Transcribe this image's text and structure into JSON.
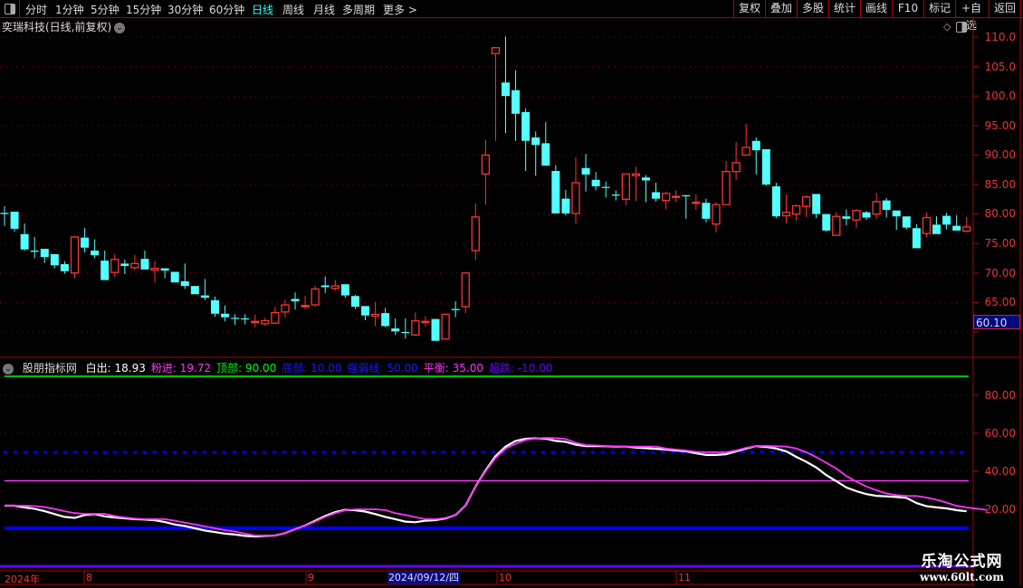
{
  "toolbar": {
    "periods": [
      "分时",
      "1分钟",
      "5分钟",
      "15分钟",
      "30分钟",
      "60分钟",
      "日线",
      "周线",
      "月线",
      "多周期",
      "更多 >"
    ],
    "active_period": "日线",
    "buttons": [
      "复权",
      "叠加",
      "多股",
      "统计",
      "画线",
      "F10",
      "标记",
      "+自选",
      "返回"
    ]
  },
  "main": {
    "title": "奕瑞科技(日线,前复权)",
    "price_axis": [
      "110.0",
      "105.0",
      "100.0",
      "95.00",
      "90.00",
      "85.00",
      "80.00",
      "75.00",
      "70.00",
      "65.00"
    ],
    "cursor_price": "60.10"
  },
  "indicator": {
    "name": "股朋指标网",
    "values": [
      {
        "label": "白出",
        "value": "18.93",
        "color": "#ffffff"
      },
      {
        "label": "粉进",
        "value": "19.72",
        "color": "#ff33ff"
      },
      {
        "label": "顶部",
        "value": "90.00",
        "color": "#00ff00"
      },
      {
        "label": "底部",
        "value": "10.00",
        "color": "#0000ff"
      },
      {
        "label": "强弱线",
        "value": "50.00",
        "color": "#0000ff"
      },
      {
        "label": "平衡",
        "value": "35.00",
        "color": "#ff33ff"
      },
      {
        "label": "超跌",
        "value": "-10.00",
        "color": "#6600ff"
      }
    ],
    "axis": [
      "80.00",
      "60.00",
      "40.00",
      "20.00"
    ]
  },
  "date_axis": {
    "labels": [
      "2024年",
      "8",
      "9",
      "10",
      "11"
    ],
    "highlight": "2024/09/12/四"
  },
  "watermark": {
    "line1": "乐淘公式网",
    "line2": "www.60lt.com"
  },
  "chart_data": {
    "type": "candlestick",
    "up_color": "#ff3333",
    "down_color": "#54ffff",
    "ylim": [
      59,
      111
    ],
    "ohlc": [
      [
        80.2,
        81.3,
        78.0,
        80.0
      ],
      [
        80.4,
        80.4,
        77.0,
        77.5
      ],
      [
        76.6,
        78.4,
        73.8,
        74.0
      ],
      [
        73.8,
        76.1,
        72.5,
        73.6
      ],
      [
        74.1,
        74.1,
        71.7,
        72.7
      ],
      [
        73.2,
        73.2,
        70.8,
        71.3
      ],
      [
        71.5,
        72.0,
        69.9,
        70.3
      ],
      [
        70.0,
        76.3,
        69.1,
        76.1
      ],
      [
        76.0,
        77.6,
        73.5,
        74.3
      ],
      [
        73.8,
        75.7,
        72.5,
        73.0
      ],
      [
        72.1,
        73.8,
        68.8,
        68.8
      ],
      [
        70.1,
        73.2,
        69.3,
        72.3
      ],
      [
        71.6,
        72.3,
        69.8,
        71.2
      ],
      [
        70.9,
        73.1,
        70.5,
        71.6
      ],
      [
        72.4,
        73.8,
        70.6,
        70.6
      ],
      [
        70.5,
        72.1,
        68.4,
        70.8
      ],
      [
        70.8,
        70.8,
        69.1,
        70.4
      ],
      [
        70.2,
        70.2,
        68.4,
        68.4
      ],
      [
        68.6,
        71.6,
        67.3,
        67.8
      ],
      [
        67.8,
        67.8,
        66.4,
        66.4
      ],
      [
        66.2,
        69.0,
        65.4,
        65.8
      ],
      [
        65.4,
        66.0,
        62.6,
        63.1
      ],
      [
        63.1,
        64.5,
        61.8,
        62.5
      ],
      [
        62.4,
        63.0,
        61.2,
        62.3
      ],
      [
        62.3,
        63.0,
        61.3,
        62.2
      ],
      [
        61.7,
        63.0,
        60.8,
        61.8
      ],
      [
        61.4,
        62.4,
        61.0,
        61.9
      ],
      [
        61.5,
        64.2,
        61.5,
        63.3
      ],
      [
        63.4,
        65.5,
        62.4,
        64.6
      ],
      [
        65.6,
        66.7,
        63.8,
        65.2
      ],
      [
        64.3,
        66.1,
        63.9,
        64.5
      ],
      [
        64.6,
        67.8,
        64.3,
        67.3
      ],
      [
        67.9,
        69.4,
        66.6,
        67.6
      ],
      [
        67.4,
        68.8,
        67.0,
        67.8
      ],
      [
        68.1,
        68.1,
        65.8,
        66.2
      ],
      [
        66.1,
        66.3,
        63.9,
        64.3
      ],
      [
        64.4,
        64.4,
        62.0,
        62.8
      ],
      [
        62.7,
        65.1,
        61.0,
        63.0
      ],
      [
        63.2,
        64.1,
        60.8,
        61.0
      ],
      [
        60.6,
        62.3,
        59.5,
        60.1
      ],
      [
        60.0,
        62.3,
        58.9,
        59.9
      ],
      [
        59.5,
        63.3,
        59.3,
        61.9
      ],
      [
        61.7,
        62.7,
        60.9,
        61.8
      ],
      [
        62.2,
        62.2,
        58.5,
        58.5
      ],
      [
        58.8,
        63.0,
        58.8,
        63.0
      ],
      [
        63.9,
        65.2,
        62.5,
        63.7
      ],
      [
        64.3,
        70.0,
        63.2,
        70.0
      ],
      [
        73.8,
        81.8,
        72.2,
        79.5
      ],
      [
        86.8,
        92.5,
        81.6,
        90.0
      ],
      [
        107.2,
        108.2,
        92.4,
        108.2
      ],
      [
        102.3,
        110.1,
        93.7,
        100.0
      ],
      [
        101.0,
        104.4,
        92.4,
        97.0
      ],
      [
        97.3,
        97.9,
        87.3,
        92.4
      ],
      [
        93.0,
        94.0,
        86.5,
        91.7
      ],
      [
        92.0,
        95.6,
        88.2,
        88.2
      ],
      [
        87.3,
        88.3,
        80.1,
        80.1
      ],
      [
        82.6,
        84.1,
        79.8,
        80.1
      ],
      [
        80.1,
        89.6,
        78.4,
        85.3
      ],
      [
        87.8,
        90.2,
        83.8,
        86.7
      ],
      [
        85.8,
        87.1,
        84.0,
        84.7
      ],
      [
        84.6,
        85.5,
        82.8,
        84.5
      ],
      [
        83.3,
        84.0,
        82.3,
        83.2
      ],
      [
        82.5,
        86.8,
        81.5,
        86.8
      ],
      [
        86.5,
        88.0,
        82.2,
        86.8
      ],
      [
        86.2,
        86.6,
        82.0,
        85.7
      ],
      [
        83.7,
        85.3,
        82.1,
        82.6
      ],
      [
        82.3,
        83.8,
        80.8,
        83.5
      ],
      [
        82.9,
        84.0,
        82.0,
        83.0
      ],
      [
        83.2,
        83.2,
        79.2,
        83.0
      ],
      [
        81.9,
        83.4,
        80.7,
        82.0
      ],
      [
        81.9,
        82.6,
        78.6,
        79.2
      ],
      [
        78.3,
        82.0,
        76.9,
        81.6
      ],
      [
        81.6,
        89.0,
        81.6,
        87.2
      ],
      [
        87.2,
        92.2,
        85.8,
        88.7
      ],
      [
        90.0,
        95.3,
        90.0,
        91.3
      ],
      [
        92.4,
        93.0,
        86.7,
        90.8
      ],
      [
        91.0,
        91.0,
        84.8,
        85.0
      ],
      [
        84.7,
        85.3,
        79.3,
        79.6
      ],
      [
        79.7,
        83.3,
        78.5,
        80.3
      ],
      [
        80.0,
        81.6,
        78.9,
        81.4
      ],
      [
        81.3,
        83.2,
        79.5,
        82.9
      ],
      [
        83.4,
        83.4,
        79.3,
        80.0
      ],
      [
        80.0,
        80.0,
        77.0,
        77.2
      ],
      [
        76.4,
        80.3,
        76.4,
        79.6
      ],
      [
        79.6,
        80.8,
        78.1,
        79.2
      ],
      [
        79.0,
        80.8,
        77.7,
        80.6
      ],
      [
        80.3,
        80.5,
        79.0,
        79.4
      ],
      [
        80.0,
        83.6,
        79.2,
        82.1
      ],
      [
        82.3,
        82.7,
        79.4,
        80.7
      ],
      [
        80.6,
        80.6,
        77.3,
        79.6
      ],
      [
        79.6,
        79.6,
        77.4,
        77.7
      ],
      [
        77.6,
        78.3,
        74.2,
        74.2
      ],
      [
        76.7,
        80.3,
        76.1,
        79.4
      ],
      [
        78.2,
        79.6,
        76.6,
        76.6
      ],
      [
        79.7,
        80.2,
        77.4,
        78.2
      ],
      [
        78.0,
        79.8,
        77.2,
        77.2
      ],
      [
        77.1,
        79.5,
        76.9,
        77.8
      ]
    ],
    "indicator_ylim": [
      -10,
      95
    ],
    "series": [
      {
        "name": "白出",
        "color": "#ffffff",
        "values": [
          21.9,
          21.9,
          21,
          20.3,
          19,
          17.5,
          16,
          15.5,
          17,
          17.5,
          16.3,
          15.7,
          15.3,
          14.8,
          14.6,
          14.2,
          13.3,
          12,
          11.2,
          10,
          8.8,
          8,
          7.2,
          6.7,
          6,
          5.7,
          6,
          6.2,
          7.5,
          9.5,
          11.5,
          14,
          16.5,
          18.5,
          19.7,
          19.5,
          18.8,
          17.5,
          16,
          14.8,
          13.5,
          13.2,
          14,
          14.3,
          15.2,
          17,
          22,
          32,
          40.5,
          48,
          53,
          56,
          57.1,
          57.4,
          57.2,
          56,
          55.5,
          54,
          53.3,
          53.3,
          53.2,
          53,
          53,
          52.5,
          52.2,
          51.8,
          51.5,
          51,
          50.5,
          49.5,
          48.6,
          48.6,
          49,
          50.5,
          52,
          53.3,
          52.8,
          52,
          50.5,
          47.6,
          45,
          42,
          38,
          34.8,
          31.5,
          29.5,
          28,
          27.1,
          26.8,
          26.5,
          26,
          23.3,
          21.6,
          21,
          20.5,
          19.5,
          18.93
        ]
      },
      {
        "name": "粉进",
        "color": "#ff33ff",
        "values": [
          21.9,
          21.9,
          21.9,
          21.7,
          21.2,
          20.2,
          19,
          18,
          17.6,
          17.6,
          17.6,
          16.5,
          15.7,
          15.2,
          14.8,
          14.8,
          14.8,
          14,
          13,
          12,
          11,
          10,
          9,
          8.3,
          7.2,
          6.2,
          6.2,
          6.2,
          7.5,
          9.5,
          11.4,
          13.5,
          16,
          18,
          19.5,
          20,
          20,
          20,
          19.5,
          18,
          17,
          15.8,
          14.8,
          14.8,
          15.5,
          17,
          22,
          32,
          40,
          47,
          52,
          54.5,
          56.5,
          57.3,
          57.6,
          57.5,
          57,
          55,
          53.8,
          53.6,
          53.3,
          53.2,
          53,
          53,
          53,
          53,
          52,
          51.5,
          51,
          50.3,
          50,
          50,
          50,
          51,
          52.4,
          53.3,
          53.4,
          53.2,
          53,
          52,
          50,
          47.5,
          44.5,
          41.5,
          37.5,
          34.5,
          32,
          30,
          28.3,
          27.5,
          27.1,
          27,
          26.2,
          25,
          23.5,
          21.8,
          21,
          20.3,
          19.72
        ]
      }
    ],
    "reference_lines": [
      {
        "label": "顶部",
        "value": 90,
        "color": "#00ff00",
        "style": "solid"
      },
      {
        "label": "强弱线",
        "value": 50,
        "color": "#0000ff",
        "style": "dotted"
      },
      {
        "label": "平衡",
        "value": 35,
        "color": "#ff33ff",
        "style": "solid"
      },
      {
        "label": "底部",
        "value": 10,
        "color": "#0000ff",
        "style": "thick"
      },
      {
        "label": "超跌",
        "value": -10,
        "color": "#6600ff",
        "style": "solid"
      }
    ],
    "grid": true
  }
}
